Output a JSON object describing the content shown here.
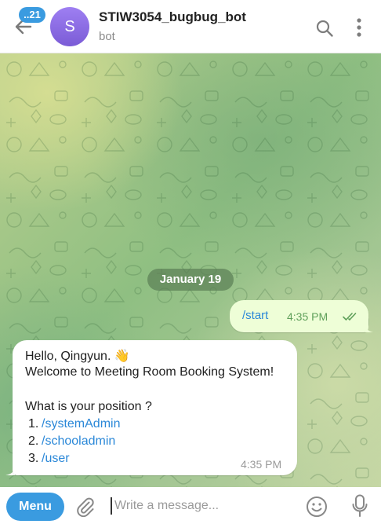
{
  "header": {
    "unread_count": "..21",
    "avatar_letter": "S",
    "title": "STIW3054_bugbug_bot",
    "subtitle": "bot"
  },
  "chat": {
    "date_separator": "January 19",
    "outgoing": {
      "text": "/start",
      "time": "4:35 PM",
      "status": "read"
    },
    "incoming": {
      "greeting": "Hello, Qingyun. 👋",
      "welcome": "Welcome to Meeting Room Booking System!",
      "question": "What is your position ?",
      "options": [
        {
          "num": "1.",
          "command": "/systemAdmin"
        },
        {
          "num": "2.",
          "command": "/schooladmin"
        },
        {
          "num": "3.",
          "command": "/user"
        }
      ],
      "time": "4:35 PM"
    }
  },
  "composer": {
    "menu_label": "Menu",
    "placeholder": "Write a message..."
  },
  "colors": {
    "accent": "#3a9be0",
    "avatar": "#8b6be6",
    "outgoing_bubble": "#eefed7",
    "link": "#2b88d8"
  },
  "icons": {
    "back": "arrow-left-icon",
    "search": "search-icon",
    "more": "more-vertical-icon",
    "read_status": "double-check-icon",
    "attach": "paperclip-icon",
    "emoji": "emoji-icon",
    "mic": "microphone-icon"
  }
}
